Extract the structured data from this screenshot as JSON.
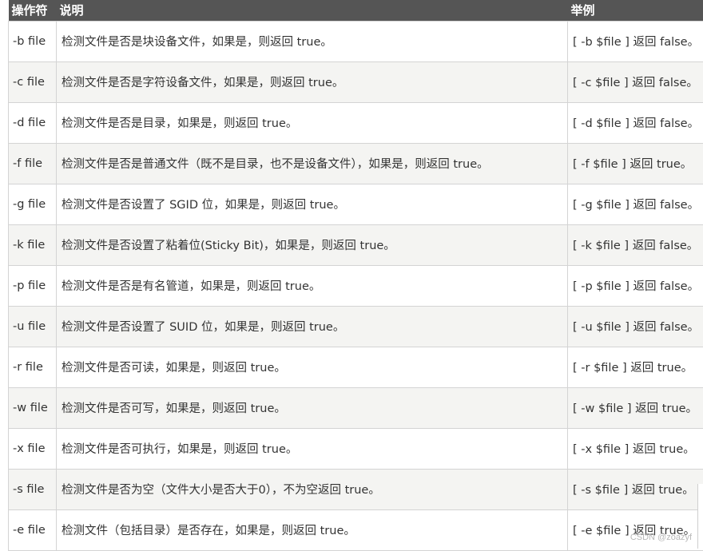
{
  "table": {
    "headers": [
      "操作符",
      "说明",
      "举例"
    ],
    "rows": [
      {
        "op": "-b file",
        "desc": "检测文件是否是块设备文件，如果是，则返回 true。",
        "example": "[ -b $file ] 返回 false。"
      },
      {
        "op": "-c file",
        "desc": "检测文件是否是字符设备文件，如果是，则返回 true。",
        "example": "[ -c $file ] 返回 false。"
      },
      {
        "op": "-d file",
        "desc": "检测文件是否是目录，如果是，则返回 true。",
        "example": "[ -d $file ] 返回 false。"
      },
      {
        "op": "-f file",
        "desc": "检测文件是否是普通文件（既不是目录，也不是设备文件），如果是，则返回 true。",
        "example": "[ -f $file ] 返回 true。"
      },
      {
        "op": "-g file",
        "desc": "检测文件是否设置了 SGID 位，如果是，则返回 true。",
        "example": "[ -g $file ] 返回 false。"
      },
      {
        "op": "-k file",
        "desc": "检测文件是否设置了粘着位(Sticky Bit)，如果是，则返回 true。",
        "example": "[ -k $file ] 返回 false。"
      },
      {
        "op": "-p file",
        "desc": "检测文件是否是有名管道，如果是，则返回 true。",
        "example": "[ -p $file ] 返回 false。"
      },
      {
        "op": "-u file",
        "desc": "检测文件是否设置了 SUID 位，如果是，则返回 true。",
        "example": "[ -u $file ] 返回 false。"
      },
      {
        "op": "-r file",
        "desc": "检测文件是否可读，如果是，则返回 true。",
        "example": "[ -r $file ] 返回 true。"
      },
      {
        "op": "-w file",
        "desc": "检测文件是否可写，如果是，则返回 true。",
        "example": "[ -w $file ] 返回 true。"
      },
      {
        "op": "-x file",
        "desc": "检测文件是否可执行，如果是，则返回 true。",
        "example": "[ -x $file ] 返回 true。"
      },
      {
        "op": "-s file",
        "desc": "检测文件是否为空（文件大小是否大于0），不为空返回 true。",
        "example": "[ -s $file ] 返回 true。"
      },
      {
        "op": "-e file",
        "desc": "检测文件（包括目录）是否存在，如果是，则返回 true。",
        "example": "[ -e $file ] 返回 true。"
      }
    ]
  },
  "watermark": "CSDN @zoazyf"
}
